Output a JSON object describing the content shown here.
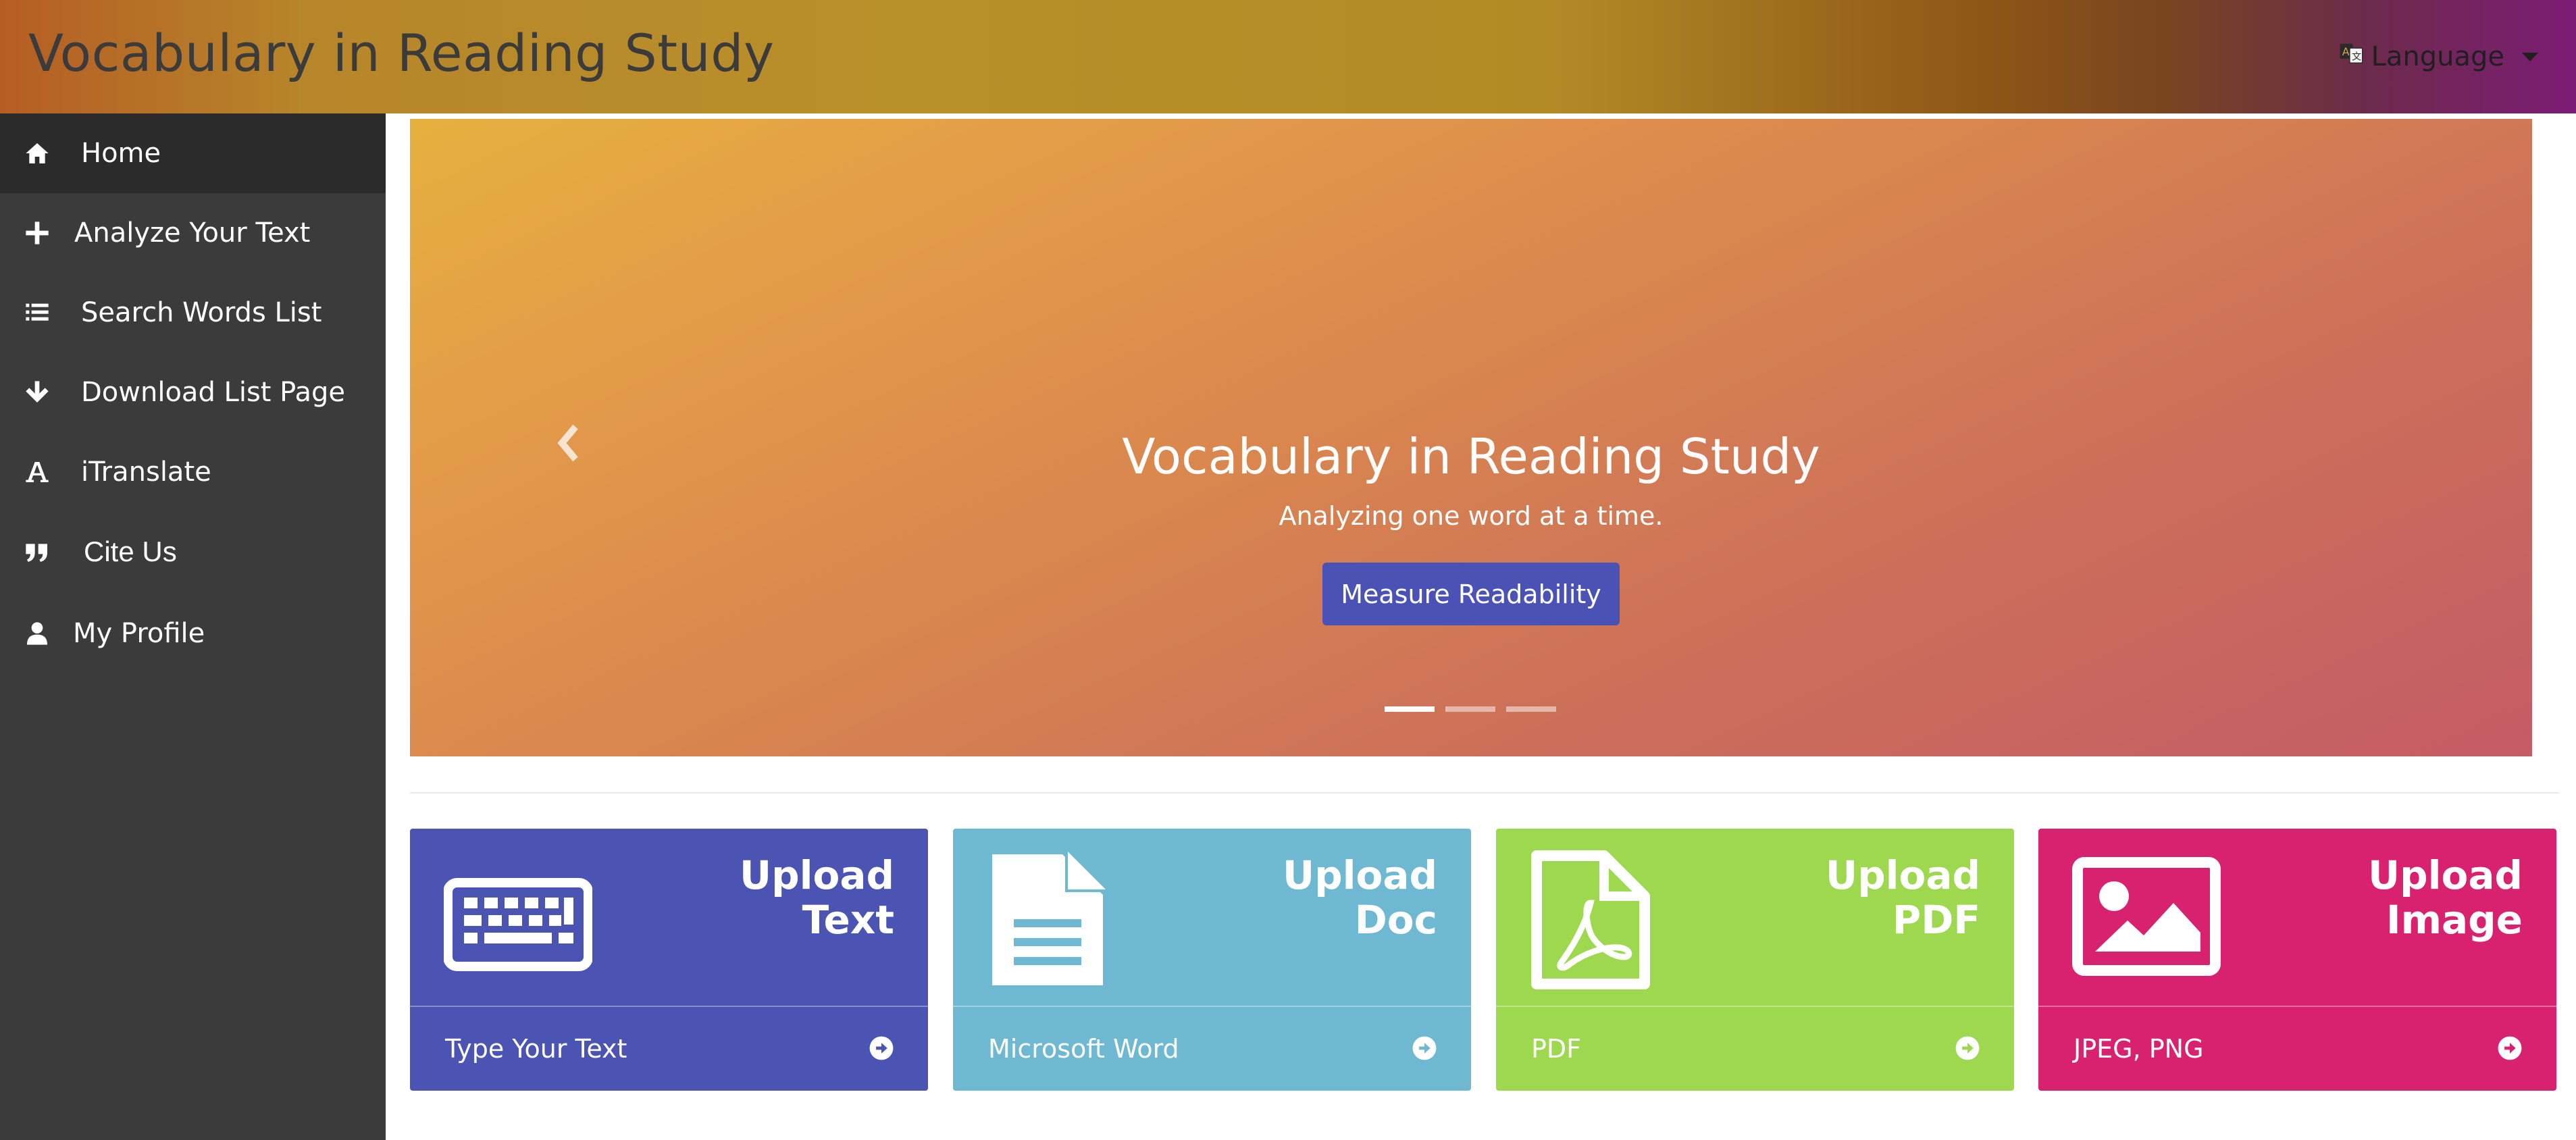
{
  "header": {
    "title": "Vocabulary in Reading Study",
    "language_label": "Language",
    "language_icon": "translate-icon"
  },
  "sidebar": {
    "items": [
      {
        "label": "Home",
        "icon": "home-icon",
        "active": true
      },
      {
        "label": "Analyze Your Text",
        "icon": "plus-icon"
      },
      {
        "label": "Search Words List",
        "icon": "list-icon"
      },
      {
        "label": "Download List Page",
        "icon": "arrow-down-icon"
      },
      {
        "label": "iTranslate",
        "icon": "font-icon"
      },
      {
        "label": "Cite Us",
        "icon": "quote-icon"
      },
      {
        "label": "My Profile",
        "icon": "user-icon"
      }
    ]
  },
  "carousel": {
    "title": "Vocabulary in Reading Study",
    "subtitle": "Analyzing one word at a time.",
    "button_label": "Measure Readability",
    "slides_count": 3,
    "active_slide": 1,
    "gradient_colors": [
      "#e6b03e",
      "#c55b66"
    ]
  },
  "cards": [
    {
      "title_line1": "Upload",
      "title_line2": "Text",
      "footer": "Type Your Text",
      "icon": "keyboard-icon",
      "color": "#4b53b3"
    },
    {
      "title_line1": "Upload",
      "title_line2": "Doc",
      "footer": "Microsoft Word",
      "icon": "document-icon",
      "color": "#6eb8d2"
    },
    {
      "title_line1": "Upload",
      "title_line2": "PDF",
      "footer": "PDF",
      "icon": "pdf-file-icon",
      "color": "#9dd84f"
    },
    {
      "title_line1": "Upload",
      "title_line2": "Image",
      "footer": "JPEG, PNG",
      "icon": "image-icon",
      "color": "#d9226f"
    }
  ]
}
